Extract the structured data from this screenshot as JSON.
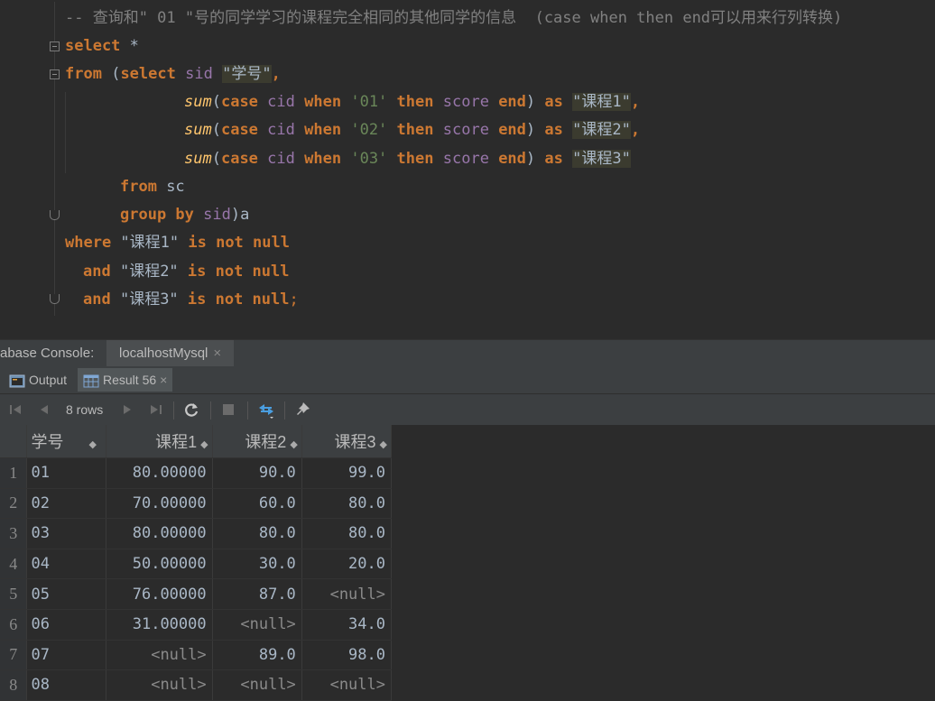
{
  "editor": {
    "comment": "-- 查询和\" 01 \"号的同学学习的课程完全相同的其他同学的信息  (case when then end可以用来行列转换)",
    "lines": {
      "l2": {
        "kw1": "select",
        "rest": " *"
      },
      "l3": {
        "kw1": "from",
        "p1": " (",
        "kw2": "select",
        "sp": " ",
        "col": "sid",
        "sp2": " ",
        "alias": "\"学号\"",
        "comma": ","
      },
      "l4": {
        "fn": "sum",
        "p1": "(",
        "kw1": "case",
        "sp1": " ",
        "col1": "cid",
        "sp2": " ",
        "kw2": "when",
        "sp3": " ",
        "str": "'01'",
        "sp4": " ",
        "kw3": "then",
        "sp5": " ",
        "col2": "score",
        "sp6": " ",
        "kw4": "end",
        "p2": ") ",
        "kw5": "as",
        "sp7": " ",
        "alias": "\"课程1\"",
        "comma": ","
      },
      "l5": {
        "fn": "sum",
        "p1": "(",
        "kw1": "case",
        "sp1": " ",
        "col1": "cid",
        "sp2": " ",
        "kw2": "when",
        "sp3": " ",
        "str": "'02'",
        "sp4": " ",
        "kw3": "then",
        "sp5": " ",
        "col2": "score",
        "sp6": " ",
        "kw4": "end",
        "p2": ") ",
        "kw5": "as",
        "sp7": " ",
        "alias": "\"课程2\"",
        "comma": ","
      },
      "l6": {
        "fn": "sum",
        "p1": "(",
        "kw1": "case",
        "sp1": " ",
        "col1": "cid",
        "sp2": " ",
        "kw2": "when",
        "sp3": " ",
        "str": "'03'",
        "sp4": " ",
        "kw3": "then",
        "sp5": " ",
        "col2": "score",
        "sp6": " ",
        "kw4": "end",
        "p2": ") ",
        "kw5": "as",
        "sp7": " ",
        "alias": "\"课程3\""
      },
      "l7": {
        "kw1": "from",
        "rest": " sc"
      },
      "l8": {
        "kw1": "group by",
        "sp": " ",
        "col": "sid",
        "rest": ")a"
      },
      "l9": {
        "kw1": "where",
        "str": " \"课程1\" ",
        "kw2": "is not null"
      },
      "l10": {
        "kw1": "and",
        "str": " \"课程2\" ",
        "kw2": "is not null"
      },
      "l11": {
        "kw1": "and",
        "str": " \"课程3\" ",
        "kw2": "is not null",
        "semi": ";"
      }
    }
  },
  "console": {
    "title": "abase Console:",
    "tab": "localhostMysql",
    "tab_close": "×"
  },
  "subtabs": {
    "output": "Output",
    "result": "Result 56",
    "close": "×"
  },
  "toolbar": {
    "rows": "8 rows"
  },
  "grid": {
    "columns": [
      "学号",
      "课程1",
      "课程2",
      "课程3"
    ],
    "rows": [
      {
        "n": "1",
        "c": [
          "01",
          "80.00000",
          "90.0",
          "99.0"
        ]
      },
      {
        "n": "2",
        "c": [
          "02",
          "70.00000",
          "60.0",
          "80.0"
        ]
      },
      {
        "n": "3",
        "c": [
          "03",
          "80.00000",
          "80.0",
          "80.0"
        ]
      },
      {
        "n": "4",
        "c": [
          "04",
          "50.00000",
          "30.0",
          "20.0"
        ]
      },
      {
        "n": "5",
        "c": [
          "05",
          "76.00000",
          "87.0",
          "<null>"
        ]
      },
      {
        "n": "6",
        "c": [
          "06",
          "31.00000",
          "<null>",
          "34.0"
        ]
      },
      {
        "n": "7",
        "c": [
          "07",
          "<null>",
          "89.0",
          "98.0"
        ]
      },
      {
        "n": "8",
        "c": [
          "08",
          "<null>",
          "<null>",
          "<null>"
        ]
      }
    ]
  },
  "colors": {
    "keyword": "#cc7832",
    "function": "#ffc66d",
    "column": "#9876aa",
    "string": "#6a8759",
    "comment": "#808080",
    "background": "#2b2b2b"
  }
}
